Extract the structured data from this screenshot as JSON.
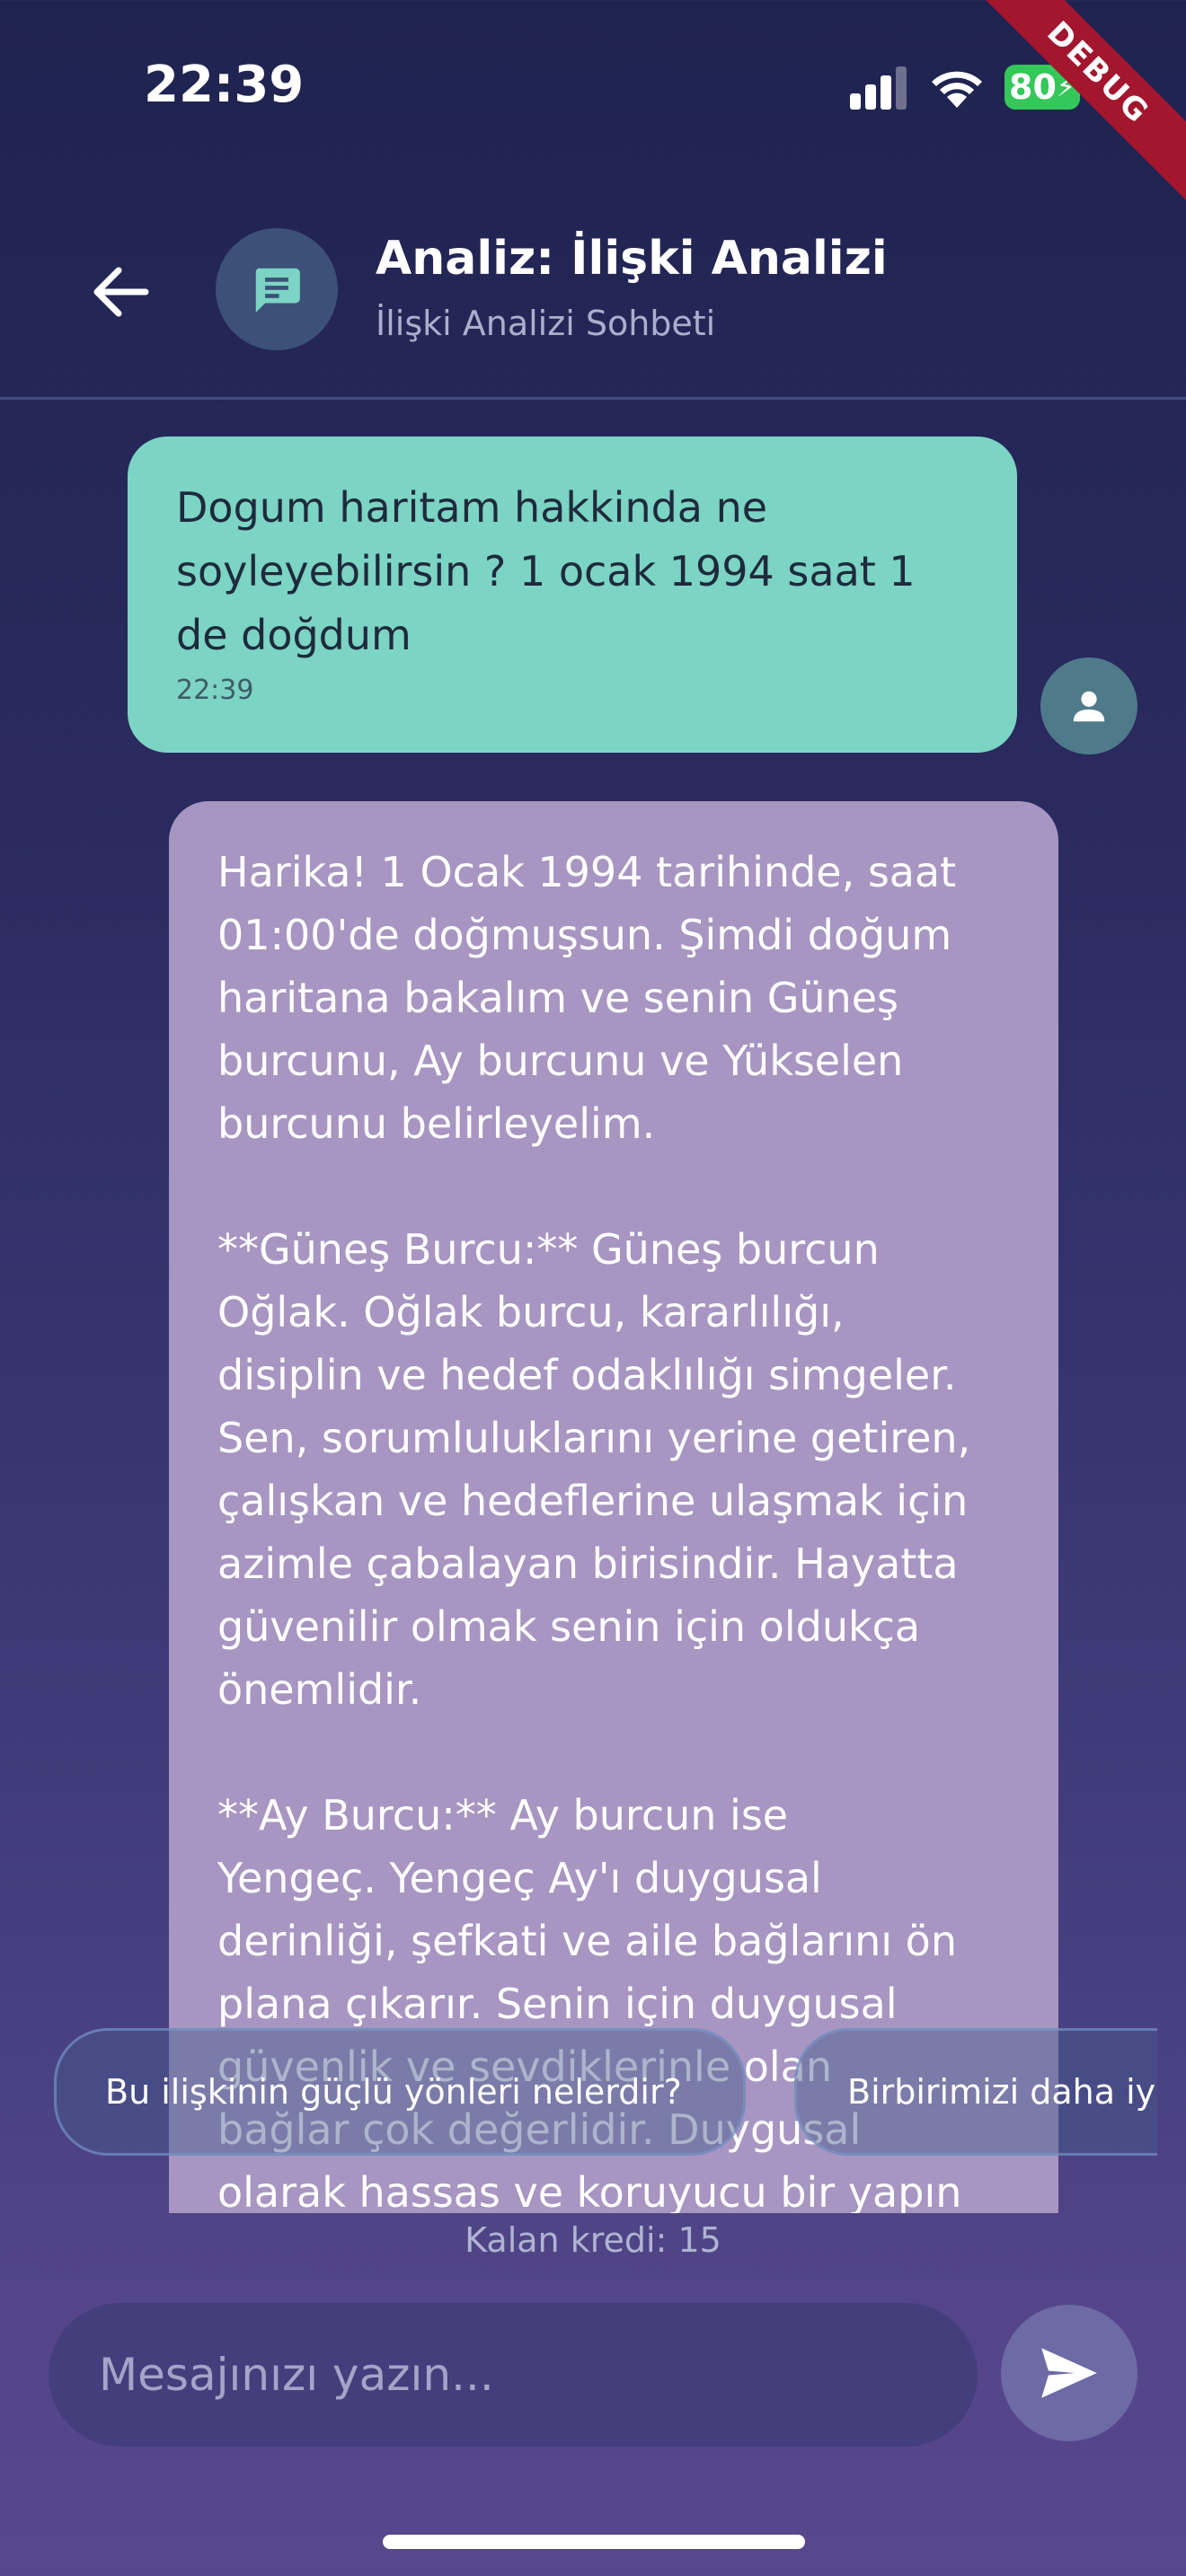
{
  "status": {
    "time": "22:39",
    "battery": "80",
    "debug": "DEBUG"
  },
  "header": {
    "title": "Analiz: İlişki Analizi",
    "subtitle": "İlişki Analizi Sohbeti"
  },
  "messages": {
    "user": {
      "lines": [
        "Dogum haritam hakkinda ne",
        "soyleyebilirsin ? 1 ocak 1994 saat 1",
        "de doğdum"
      ],
      "time": "22:39"
    },
    "assistant": {
      "paragraphs": [
        [
          "Harika! 1 Ocak 1994 tarihinde, saat",
          "01:00'de doğmuşsun. Şimdi doğum",
          "haritana bakalım ve senin Güneş",
          "burcunu, Ay burcunu ve Yükselen",
          "burcunu belirleyelim."
        ],
        [
          "**Güneş Burcu:** Güneş burcun",
          "Oğlak. Oğlak burcu, kararlılığı,",
          "disiplin ve hedef odaklılığı simgeler.",
          "Sen, sorumluluklarını yerine getiren,",
          "çalışkan ve hedeflerine ulaşmak için",
          "azimle çabalayan birisindir. Hayatta",
          "güvenilir olmak senin için oldukça",
          "önemlidir."
        ],
        [
          "**Ay Burcu:** Ay burcun ise",
          "Yengeç. Yengeç Ay'ı duygusal",
          "derinliği, şefkati ve aile bağlarını ön",
          "plana çıkarır. Senin için duygusal",
          "güvenlik ve sevdiklerinle olan",
          "bağlar çok değerlidir. Duygusal",
          "olarak hassas ve koruyucu bir yapın"
        ]
      ]
    }
  },
  "suggestions": [
    "Bu ilişkinin güçlü yönleri nelerdir?",
    "Birbirimizi daha iy"
  ],
  "credits": "Kalan kredi: 15",
  "composer": {
    "placeholder": "Mesajınızı yazın..."
  },
  "colors": {
    "user_bubble": "#7cd4c4",
    "assistant_bubble": "#a795c2",
    "battery": "#34c759",
    "debug": "#a3162e"
  }
}
